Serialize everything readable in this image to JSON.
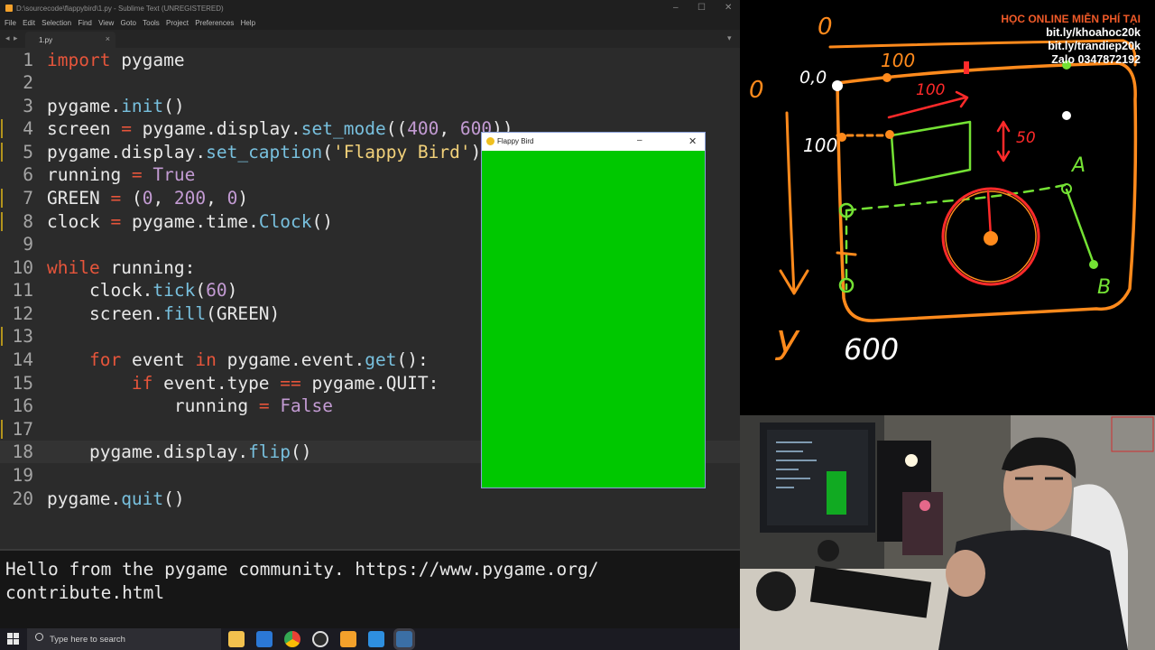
{
  "window": {
    "title": "D:\\sourcecode\\flappybird\\1.py - Sublime Text (UNREGISTERED)",
    "controls": [
      "–",
      "☐",
      "✕"
    ]
  },
  "menu": [
    "File",
    "Edit",
    "Selection",
    "Find",
    "View",
    "Goto",
    "Tools",
    "Project",
    "Preferences",
    "Help"
  ],
  "tab": {
    "name": "1.py",
    "close": "×"
  },
  "code_lines": [
    {
      "num": "1"
    },
    {
      "num": "2"
    },
    {
      "num": "3"
    },
    {
      "num": "4"
    },
    {
      "num": "5"
    },
    {
      "num": "6"
    },
    {
      "num": "7"
    },
    {
      "num": "8"
    },
    {
      "num": "9"
    },
    {
      "num": "10"
    },
    {
      "num": "11"
    },
    {
      "num": "12"
    },
    {
      "num": "13"
    },
    {
      "num": "14"
    },
    {
      "num": "15"
    },
    {
      "num": "16"
    },
    {
      "num": "17"
    },
    {
      "num": "18"
    },
    {
      "num": "19"
    },
    {
      "num": "20"
    }
  ],
  "code": {
    "l1": {
      "kw": "import",
      "rest": " pygame"
    },
    "l3": {
      "a": "pygame.",
      "f": "init",
      "b": "()"
    },
    "l4": {
      "a": "screen ",
      "op": "=",
      "b": " pygame.display.",
      "f": "set_mode",
      "c": "((",
      "n1": "400",
      "d": ", ",
      "n2": "600",
      "e": "))"
    },
    "l5": {
      "a": "pygame.display.",
      "f": "set_caption",
      "b": "(",
      "s": "'Flappy Bird'",
      "c": ")"
    },
    "l6": {
      "a": "running ",
      "op": "=",
      "sp": " ",
      "v": "True"
    },
    "l7": {
      "a": "GREEN ",
      "op": "=",
      "b": " (",
      "n1": "0",
      "c": ", ",
      "n2": "200",
      "d": ", ",
      "n3": "0",
      "e": ")"
    },
    "l8": {
      "a": "clock ",
      "op": "=",
      "b": " pygame.time.",
      "f": "Clock",
      "c": "()"
    },
    "l10": {
      "kw": "while",
      "rest": " running:"
    },
    "l11": {
      "a": "    clock.",
      "f": "tick",
      "b": "(",
      "n": "60",
      "c": ")"
    },
    "l12": {
      "a": "    screen.",
      "f": "fill",
      "b": "(GREEN)"
    },
    "l14": {
      "ind": "    ",
      "kw": "for",
      "a": " event ",
      "kw2": "in",
      "b": " pygame.event.",
      "f": "get",
      "c": "():"
    },
    "l15": {
      "ind": "        ",
      "kw": "if",
      "a": " event.type ",
      "op": "==",
      "b": " pygame.QUIT:"
    },
    "l16": {
      "a": "            running ",
      "op": "=",
      "sp": " ",
      "v": "False"
    },
    "l18": {
      "a": "    pygame.display.",
      "f": "flip",
      "b": "()"
    },
    "l20": {
      "a": "pygame.",
      "f": "quit",
      "b": "()"
    }
  },
  "console": {
    "line1": "Hello from the pygame community. https://www.pygame.org/",
    "line2": "contribute.html"
  },
  "pygame_window": {
    "title": "Flappy Bird",
    "minimize": "–",
    "close": "✕",
    "fill_color": "#00c800"
  },
  "taskbar": {
    "search_placeholder": "Type here to search",
    "apps": [
      "file-explorer-icon",
      "mail-icon",
      "chrome-icon",
      "obs-icon",
      "sublime-icon",
      "vscode-icon",
      "python-icon"
    ]
  },
  "whiteboard": {
    "labels": [
      "0",
      "0",
      "0,0",
      "100",
      "100",
      "100",
      "50",
      "A",
      "B",
      "y",
      "600"
    ]
  },
  "promo": {
    "line1": "HỌC ONLINE MIỄN PHÍ TẠI",
    "line2": "bit.ly/khoahoc20k",
    "line3": "bit.ly/trandiep20k",
    "line4": "Zalo 0347872192"
  },
  "colors": {
    "editor_bg": "#2b2b2b",
    "keyword": "#e6553b",
    "function": "#78c0de",
    "number": "#c39bd3",
    "string": "#f2d17a",
    "drawing_orange": "#ff8a1c",
    "drawing_green": "#74e234",
    "drawing_red": "#ff2a2a"
  }
}
